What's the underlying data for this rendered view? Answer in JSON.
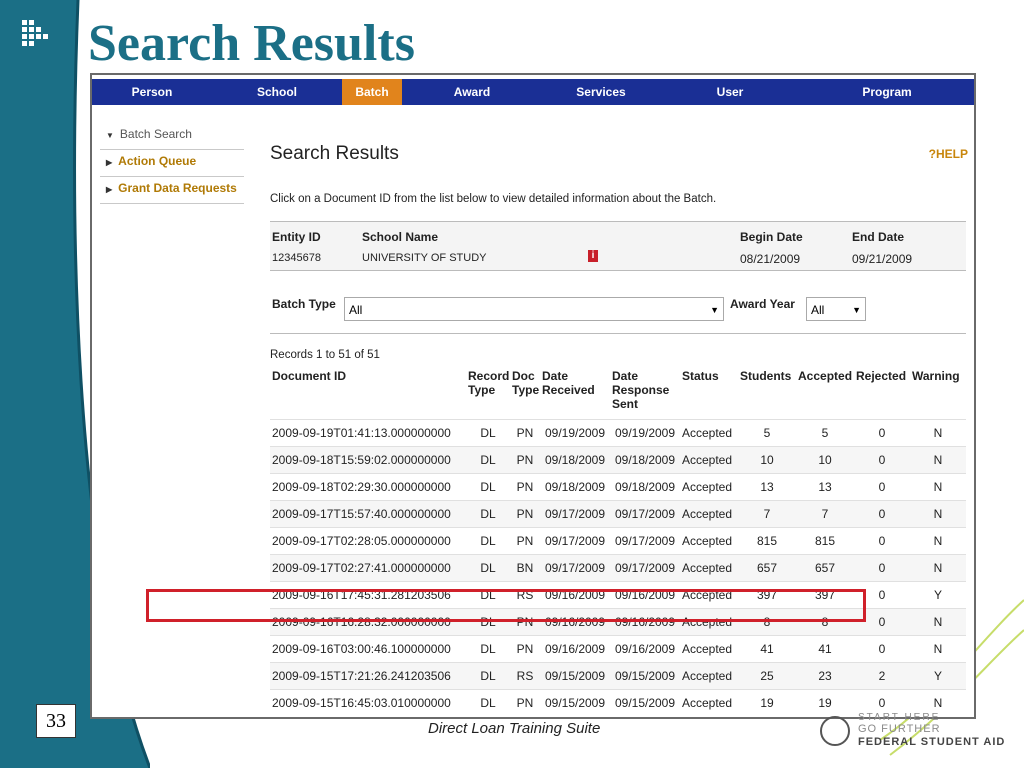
{
  "slide": {
    "title": "Search Results",
    "page_number": "33",
    "footer_text": "Direct Loan Training Suite",
    "brand_line1": "START HERE",
    "brand_line2": "GO FURTHER",
    "brand_line3": "FEDERAL STUDENT AID"
  },
  "colors": {
    "teal": "#1b6f86",
    "nav": "#1a2f95",
    "nav_active": "#e1841c",
    "link": "#6a1c84",
    "highlight": "#d0202a"
  },
  "nav": {
    "items": [
      {
        "label": "Person"
      },
      {
        "label": "School"
      },
      {
        "label": "Batch"
      },
      {
        "label": "Award"
      },
      {
        "label": "Services"
      },
      {
        "label": "User"
      },
      {
        "label": "Program"
      }
    ],
    "active": "Batch"
  },
  "sidebar": {
    "items": [
      {
        "label": "Batch Search"
      },
      {
        "label": "Action Queue"
      },
      {
        "label": "Grant Data Requests"
      }
    ]
  },
  "main": {
    "heading": "Search Results",
    "help": "HELP",
    "intro": "Click on a Document ID from the list below to view detailed information about the Batch.",
    "entity_id_label": "Entity ID",
    "entity_id": "12345678",
    "school_name_label": "School Name",
    "school_name": "UNIVERSITY OF STUDY",
    "begin_date_label": "Begin Date",
    "begin_date": "08/21/2009",
    "end_date_label": "End Date",
    "end_date": "09/21/2009",
    "batch_type_label": "Batch Type",
    "batch_type_value": "All",
    "award_year_label": "Award Year",
    "award_year_value": "All",
    "records": "Records 1 to 51 of 51"
  },
  "table": {
    "headers": [
      "Document ID",
      "Record Type",
      "Doc Type",
      "Date Received",
      "Date Response Sent",
      "Status",
      "Students",
      "Accepted",
      "Rejected",
      "Warning"
    ],
    "rows": [
      [
        "2009-09-19T01:41:13.000000000",
        "DL",
        "PN",
        "09/19/2009",
        "09/19/2009",
        "Accepted",
        "5",
        "5",
        "0",
        "N"
      ],
      [
        "2009-09-18T15:59:02.000000000",
        "DL",
        "PN",
        "09/18/2009",
        "09/18/2009",
        "Accepted",
        "10",
        "10",
        "0",
        "N"
      ],
      [
        "2009-09-18T02:29:30.000000000",
        "DL",
        "PN",
        "09/18/2009",
        "09/18/2009",
        "Accepted",
        "13",
        "13",
        "0",
        "N"
      ],
      [
        "2009-09-17T15:57:40.000000000",
        "DL",
        "PN",
        "09/17/2009",
        "09/17/2009",
        "Accepted",
        "7",
        "7",
        "0",
        "N"
      ],
      [
        "2009-09-17T02:28:05.000000000",
        "DL",
        "PN",
        "09/17/2009",
        "09/17/2009",
        "Accepted",
        "815",
        "815",
        "0",
        "N"
      ],
      [
        "2009-09-17T02:27:41.000000000",
        "DL",
        "BN",
        "09/17/2009",
        "09/17/2009",
        "Accepted",
        "657",
        "657",
        "0",
        "N"
      ],
      [
        "2009-09-16T17:45:31.281203506",
        "DL",
        "RS",
        "09/16/2009",
        "09/16/2009",
        "Accepted",
        "397",
        "397",
        "0",
        "Y"
      ],
      [
        "2009-09-16T16:28:32.000000000",
        "DL",
        "PN",
        "09/16/2009",
        "09/16/2009",
        "Accepted",
        "8",
        "8",
        "0",
        "N"
      ],
      [
        "2009-09-16T03:00:46.100000000",
        "DL",
        "PN",
        "09/16/2009",
        "09/16/2009",
        "Accepted",
        "41",
        "41",
        "0",
        "N"
      ],
      [
        "2009-09-15T17:21:26.241203506",
        "DL",
        "RS",
        "09/15/2009",
        "09/15/2009",
        "Accepted",
        "25",
        "23",
        "2",
        "Y"
      ],
      [
        "2009-09-15T16:45:03.010000000",
        "DL",
        "PN",
        "09/15/2009",
        "09/15/2009",
        "Accepted",
        "19",
        "19",
        "0",
        "N"
      ]
    ]
  }
}
